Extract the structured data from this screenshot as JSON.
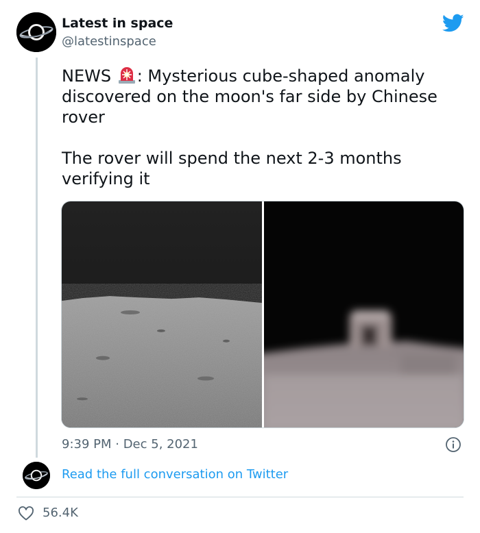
{
  "account": {
    "display_name": "Latest in space",
    "handle": "@latestinspace"
  },
  "tweet": {
    "text_prefix": "NEWS ",
    "text_body": ": Mysterious cube-shaped anomaly discovered on the moon's far side by Chinese rover\n\nThe rover will spend the next 2-3 months verifying it",
    "emoji_icon": "rotating-light-icon",
    "timestamp": "9:39 PM · Dec 5, 2021"
  },
  "media": {
    "left_image": "lunar-horizon-photo",
    "right_image": "zoomed-cube-anomaly-photo"
  },
  "footer": {
    "read_link": "Read the full conversation on Twitter",
    "likes": "56.4K"
  },
  "colors": {
    "link_blue": "#1d9bf0",
    "muted_text": "#536471",
    "border": "#cfd9de",
    "twitter_blue": "#1d9bf0"
  }
}
